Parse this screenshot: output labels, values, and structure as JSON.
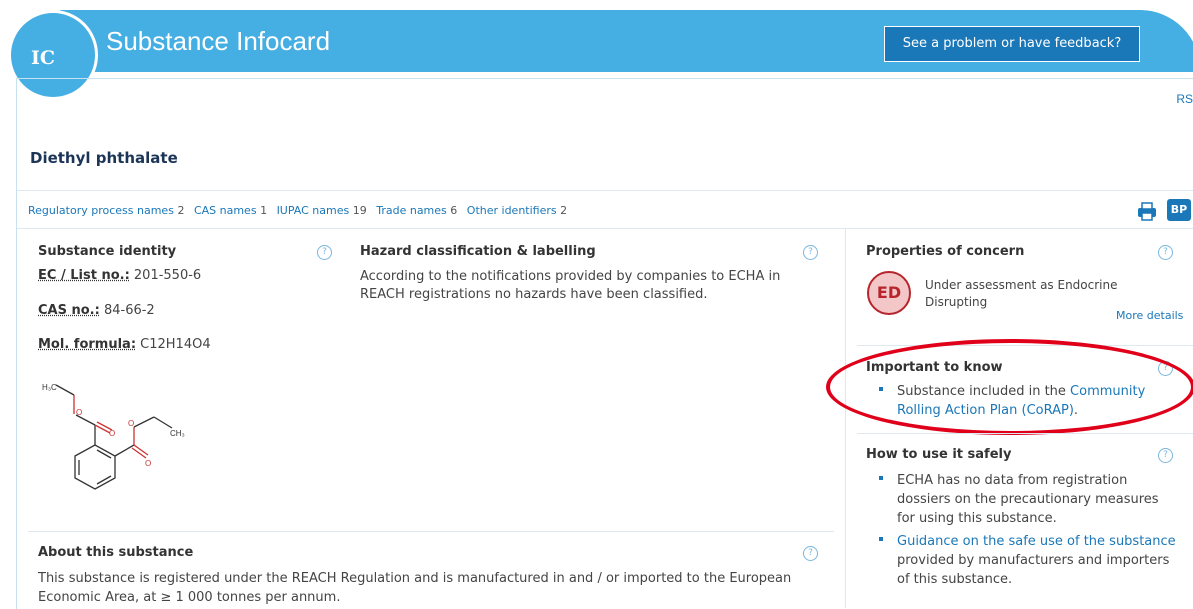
{
  "header": {
    "logo_text": "IC",
    "title": "Substance Infocard",
    "feedback_button": "See a problem or have feedback?",
    "rss_label": "RS",
    "brand_color": "#45aee2"
  },
  "substance_name": "Diethyl phthalate",
  "identifier_tabs": [
    {
      "label": "Regulatory process names",
      "count": "2"
    },
    {
      "label": "CAS names",
      "count": "1"
    },
    {
      "label": "IUPAC names",
      "count": "19"
    },
    {
      "label": "Trade names",
      "count": "6"
    },
    {
      "label": "Other identifiers",
      "count": "2"
    }
  ],
  "toolbar": {
    "print_icon": "printer-icon",
    "bp_label": "BP"
  },
  "identity": {
    "heading": "Substance identity",
    "ec_label": "EC / List no.:",
    "ec_value": "201-550-6",
    "cas_label": "CAS no.:",
    "cas_value": "84-66-2",
    "formula_label": "Mol. formula:",
    "formula_value": "C12H14O4",
    "structure_labels": {
      "h3c": "H₃C",
      "ch3": "CH₃"
    }
  },
  "hazard": {
    "heading": "Hazard classification & labelling",
    "text": "According to the notifications provided by companies to ECHA in REACH registrations no hazards have been classified."
  },
  "concern": {
    "heading": "Properties of concern",
    "badge": "ED",
    "text_line1": "Under assessment as Endocrine",
    "text_line2": "Disrupting",
    "more_details": "More details"
  },
  "important": {
    "heading": "Important to know",
    "text_prefix": "Substance included in the",
    "link_line1": "Community",
    "link_line2": "Rolling Action Plan (CoRAP)",
    "text_suffix": "."
  },
  "safe_use": {
    "heading": "How to use it safely",
    "item1": [
      "ECHA has no data from registration",
      "dossiers on the precautionary measures",
      "for using this substance."
    ],
    "item2_link": "Guidance on the safe use of the substance",
    "item2_rest": [
      "provided by manufacturers and importers",
      "of this substance."
    ]
  },
  "about": {
    "heading": "About this substance",
    "line1": "This substance is registered under the REACH Regulation and is manufactured in and / or imported to the European",
    "line2": "Economic Area, at ≥ 1 000 tonnes per annum."
  },
  "help_glyph": "?"
}
